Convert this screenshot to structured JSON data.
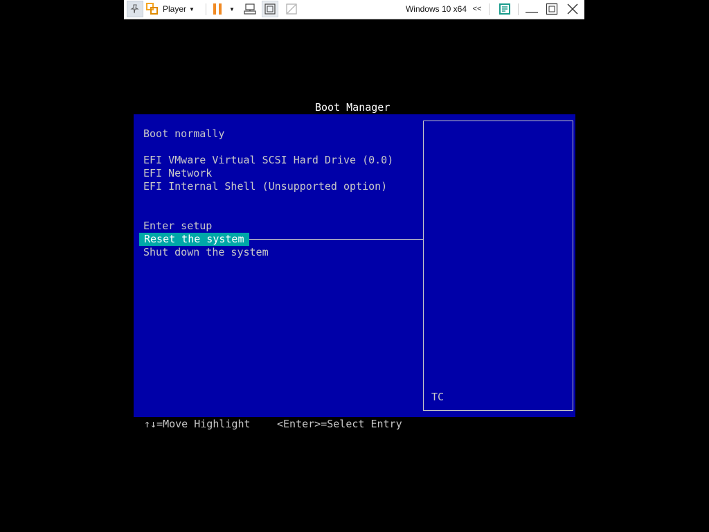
{
  "toolbar": {
    "player_label": "Player",
    "vm_name": "Windows 10 x64",
    "collapse_glyph": "<<",
    "icons": [
      "pin-icon",
      "vmware-logo-icon",
      "pause-icon",
      "send-keys-icon",
      "fit-guest-icon",
      "unity-icon",
      "notes-icon",
      "minimize-icon",
      "maximize-icon",
      "close-icon"
    ],
    "pause_color": "#f08a24"
  },
  "boot_manager": {
    "title": "Boot Manager",
    "items": [
      "Boot normally",
      "EFI VMware Virtual SCSI Hard Drive (0.0)",
      "EFI Network",
      "EFI Internal Shell (Unsupported option)",
      "Enter setup",
      "Reset the system",
      "Shut down the system"
    ],
    "selected_item": "Reset the system",
    "help_text": "TC",
    "hints": {
      "move": "↑↓=Move Highlight",
      "select": "<Enter>=Select Entry"
    },
    "colors": {
      "panel_bg": "#0000a8",
      "highlight_bg": "#00a8a8",
      "text": "#c8c8c8"
    }
  }
}
